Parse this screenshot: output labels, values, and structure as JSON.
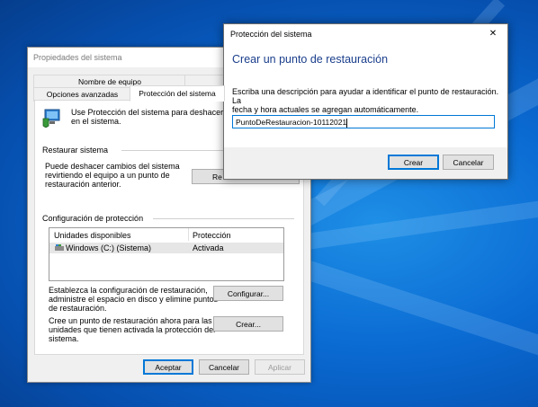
{
  "background": {
    "colors": {
      "base": "#0a6ad2",
      "dark": "#053d8c",
      "light": "#1e8fe6"
    }
  },
  "system_properties": {
    "title": "Propiedades del sistema",
    "tabs_row1": [
      "Nombre de equipo",
      ""
    ],
    "tabs_row2": [
      "Opciones avanzadas",
      "Protección del sistema",
      ""
    ],
    "intro_text_line1": "Use Protección del sistema para deshacer cambi",
    "intro_text_line2": "en el sistema.",
    "restore_section": {
      "title": "Restaurar sistema",
      "desc_line1": "Puede deshacer cambios del sistema",
      "desc_line2": "revirtiendo el equipo a un punto de",
      "desc_line3": "restauración anterior.",
      "button_label": "Re"
    },
    "protection_section": {
      "title": "Configuración de protección",
      "columns": [
        "Unidades disponibles",
        "Protección"
      ],
      "rows": [
        {
          "drive": "Windows (C:) (Sistema)",
          "status": "Activada"
        }
      ]
    },
    "configure": {
      "desc_line1": "Establezca la configuración de restauración,",
      "desc_line2": "administre el espacio en disco y elimine puntos",
      "desc_line3": "de restauración.",
      "button_label": "Configurar..."
    },
    "create": {
      "desc_line1": "Cree un punto de restauración ahora para las",
      "desc_line2": "unidades que tienen activada la protección del",
      "desc_line3": "sistema.",
      "button_label": "Crear..."
    },
    "footer": {
      "accept": "Aceptar",
      "cancel": "Cancelar",
      "apply": "Aplicar"
    }
  },
  "restore_point_dialog": {
    "title": "Protección del sistema",
    "close_glyph": "✕",
    "heading": "Crear un punto de restauración",
    "description_line1": "Escriba una descripción para ayudar a identificar el punto de restauración. La",
    "description_line2": "fecha y hora actuales se agregan automáticamente.",
    "input_value": "PuntoDeRestauracion-10112021",
    "create_button": "Crear",
    "cancel_button": "Cancelar",
    "colors": {
      "heading": "#1a3e8c",
      "focus": "#0078d7"
    }
  }
}
